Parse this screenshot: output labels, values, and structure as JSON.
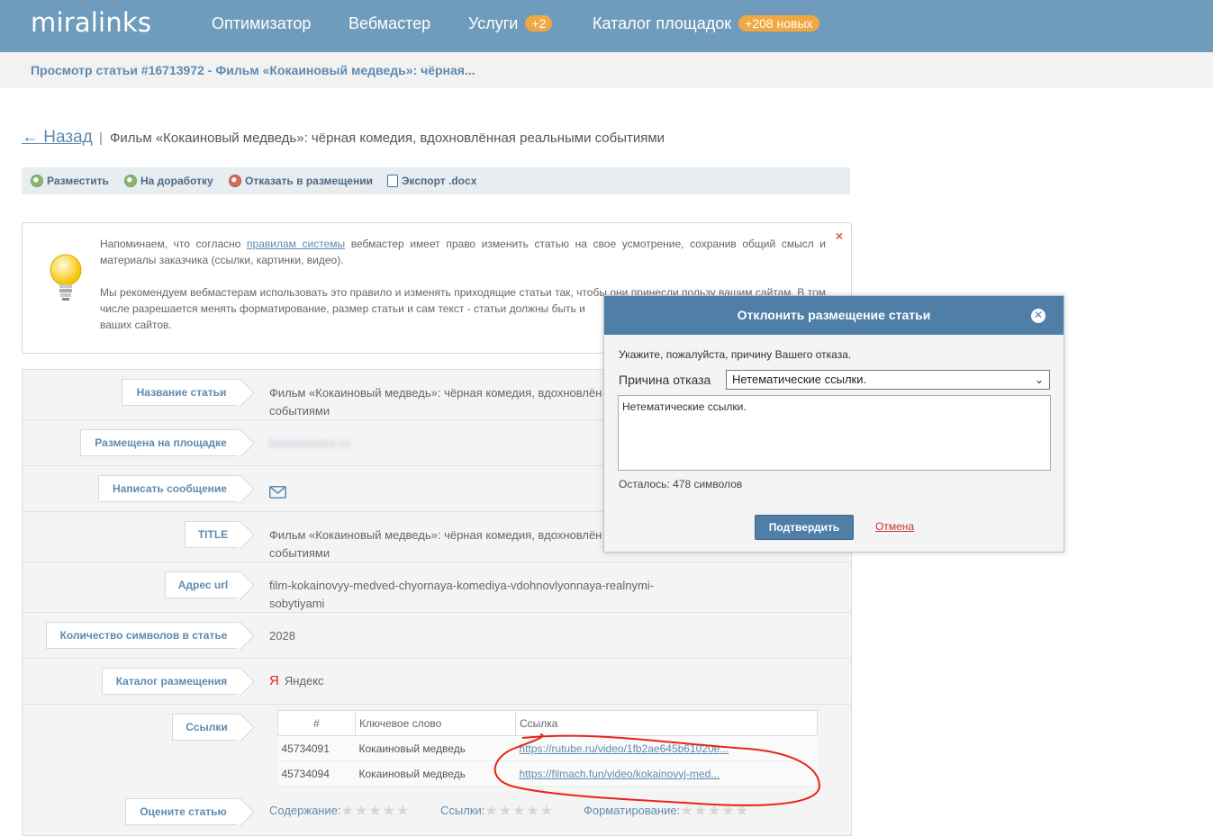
{
  "header": {
    "logo": "miralinks",
    "nav": [
      {
        "label": "Оптимизатор",
        "badge": ""
      },
      {
        "label": "Вебмастер",
        "badge": ""
      },
      {
        "label": "Услуги",
        "badge": "+2"
      },
      {
        "label": "Каталог площадок",
        "badge": "+208 новых"
      }
    ]
  },
  "breadcrumb": "Просмотр статьи #16713972 - Фильм «Кокаиновый медведь»: чёрная...",
  "page": {
    "back_label": "← Назад",
    "separator": "|",
    "title": "Фильм «Кокаиновый медведь»: чёрная комедия, вдохновлённая реальными событиями"
  },
  "toolbar": {
    "place": "Разместить",
    "rework": "На доработку",
    "refuse": "Отказать в размещении",
    "export": "Экспорт .docx"
  },
  "notice": {
    "p1_prefix": "Напоминаем, что согласно ",
    "p1_link": "правилам системы",
    "p1_suffix": " вебмастер имеет право изменить статью на свое усмотрение, сохранив общий смысл и материалы заказчика (ссылки, картинки, видео).",
    "p2": "Мы рекомендуем вебмастерам использовать это правило и изменять приходящие статьи так, чтобы они принесли пользу вашим сайтам. В том числе разрешается менять форматирование, размер статьи и сам текст - статьи должны быть и",
    "p2_end": "ваших сайтов.",
    "close": "×"
  },
  "fields": {
    "title_label": "Название статьи",
    "title_value_1": "Фильм «Кокаиновый медведь»: чёрная комедия, вдохновлён",
    "title_value_2": "событиями",
    "site_label": "Размещена на площадке",
    "site_value": "bastasoostra.ru",
    "message_label": "Написать сообщение",
    "meta_label": "TITLE",
    "meta_value_1": "Фильм «Кокаиновый медведь»: чёрная комедия, вдохновлён",
    "meta_value_2": "событиями",
    "url_label": "Адрес url",
    "url_value_1": "film-kokainovyy-medved-chyornaya-komediya-vdohnovlyonnaya-realnymi-",
    "url_value_2": "sobytiyami",
    "chars_label": "Количество символов в статье",
    "chars_value": "2028",
    "catalog_label": "Каталог размещения",
    "catalog_icon": "Я",
    "catalog_value": "Яндекс",
    "links_label": "Ссылки",
    "rate_label": "Оцените статью"
  },
  "links_table": {
    "headers": [
      "#",
      "Ключевое слово",
      "Ссылка"
    ],
    "rows": [
      {
        "id": "45734091",
        "keyword": "Кокаиновый медведь",
        "url": "https://rutube.ru/video/1fb2ae645b61020e..."
      },
      {
        "id": "45734094",
        "keyword": "Кокаиновый медведь",
        "url": "https://filmach.fun/video/kokainovyj-med..."
      }
    ]
  },
  "rating": {
    "content": "Содержание:",
    "links": "Ссылки:",
    "format": "Форматирование:",
    "stars": "★★★★★"
  },
  "dialog": {
    "title": "Отклонить размещение статьи",
    "prompt": "Укажите, пожалуйста, причину Вашего отказа.",
    "reason_label": "Причина отказа",
    "reason_selected": "Нетематические ссылки.",
    "textarea_value": "Нетематические ссылки.",
    "counter": "Осталось: 478 символов",
    "confirm": "Подтвердить",
    "cancel": "Отмена"
  }
}
